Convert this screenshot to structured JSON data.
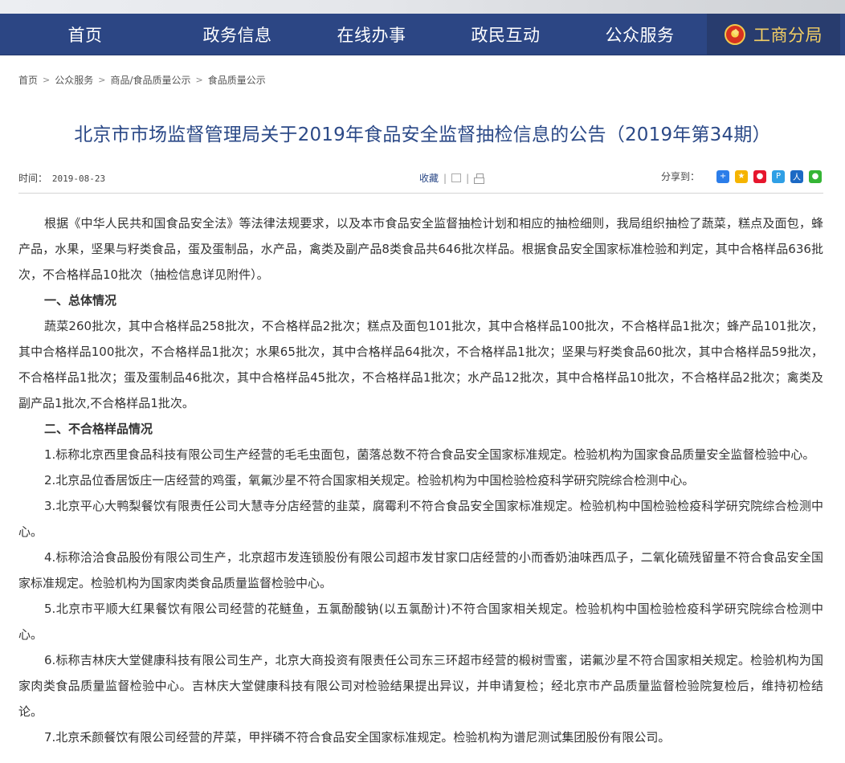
{
  "nav": {
    "items": [
      {
        "label": "首页"
      },
      {
        "label": "政务信息"
      },
      {
        "label": "在线办事"
      },
      {
        "label": "政民互动"
      },
      {
        "label": "公众服务"
      },
      {
        "label": "工商分局"
      }
    ],
    "active_index": 5
  },
  "breadcrumb": [
    "首页",
    "公众服务",
    "商品/食品质量公示",
    "食品质量公示"
  ],
  "title": "北京市市场监督管理局关于2019年食品安全监督抽检信息的公告（2019年第34期）",
  "meta": {
    "time_label": "时间：",
    "time_value": "2019-08-23",
    "favorite": "收藏",
    "share_label": "分享到：",
    "share_icons": [
      {
        "name": "plus-share-icon",
        "color": "#2b7de9",
        "glyph": "+"
      },
      {
        "name": "qzone-share-icon",
        "color": "#f5b400",
        "glyph": "★"
      },
      {
        "name": "weibo-share-icon",
        "color": "#e6162d",
        "glyph": "●"
      },
      {
        "name": "tencent-weibo-share-icon",
        "color": "#2f9fe5",
        "glyph": "P"
      },
      {
        "name": "renren-share-icon",
        "color": "#1b69c4",
        "glyph": "人"
      },
      {
        "name": "wechat-share-icon",
        "color": "#35b535",
        "glyph": "●"
      }
    ]
  },
  "content": {
    "intro": "根据《中华人民共和国食品安全法》等法律法规要求，以及本市食品安全监督抽检计划和相应的抽检细则，我局组织抽检了蔬菜，糕点及面包，蜂产品，水果，坚果与籽类食品，蛋及蛋制品，水产品，禽类及副产品8类食品共646批次样品。根据食品安全国家标准检验和判定，其中合格样品636批次，不合格样品10批次（抽检信息详见附件）。",
    "heading1": "一、总体情况",
    "overall": "蔬菜260批次，其中合格样品258批次，不合格样品2批次；糕点及面包101批次，其中合格样品100批次，不合格样品1批次；蜂产品101批次，其中合格样品100批次，不合格样品1批次；水果65批次，其中合格样品64批次，不合格样品1批次；坚果与籽类食品60批次，其中合格样品59批次，不合格样品1批次；蛋及蛋制品46批次，其中合格样品45批次，不合格样品1批次；水产品12批次，其中合格样品10批次，不合格样品2批次；禽类及副产品1批次,不合格样品1批次。",
    "heading2": "二、不合格样品情况",
    "items": [
      "1.标称北京西里食品科技有限公司生产经营的毛毛虫面包，菌落总数不符合食品安全国家标准规定。检验机构为国家食品质量安全监督检验中心。",
      "2.北京品位香居饭庄一店经营的鸡蛋，氧氟沙星不符合国家相关规定。检验机构为中国检验检疫科学研究院综合检测中心。",
      "3.北京平心大鸭梨餐饮有限责任公司大慧寺分店经营的韭菜，腐霉利不符合食品安全国家标准规定。检验机构中国检验检疫科学研究院综合检测中心。",
      "4.标称洽洽食品股份有限公司生产，北京超市发连锁股份有限公司超市发甘家口店经营的小而香奶油味西瓜子，二氧化硫残留量不符合食品安全国家标准规定。检验机构为国家肉类食品质量监督检验中心。",
      "5.北京市平顺大红果餐饮有限公司经营的花鲢鱼，五氯酚酸钠(以五氯酚计)不符合国家相关规定。检验机构中国检验检疫科学研究院综合检测中心。",
      "6.标称吉林庆大堂健康科技有限公司生产，北京大商投资有限责任公司东三环超市经营的椴树雪蜜，诺氟沙星不符合国家相关规定。检验机构为国家肉类食品质量监督检验中心。吉林庆大堂健康科技有限公司对检验结果提出异议，并申请复检；经北京市产品质量监督检验院复检后，维持初检结论。",
      "7.北京禾颜餐饮有限公司经营的芹菜，甲拌磷不符合食品安全国家标准规定。检验机构为谱尼测试集团股份有限公司。"
    ]
  }
}
